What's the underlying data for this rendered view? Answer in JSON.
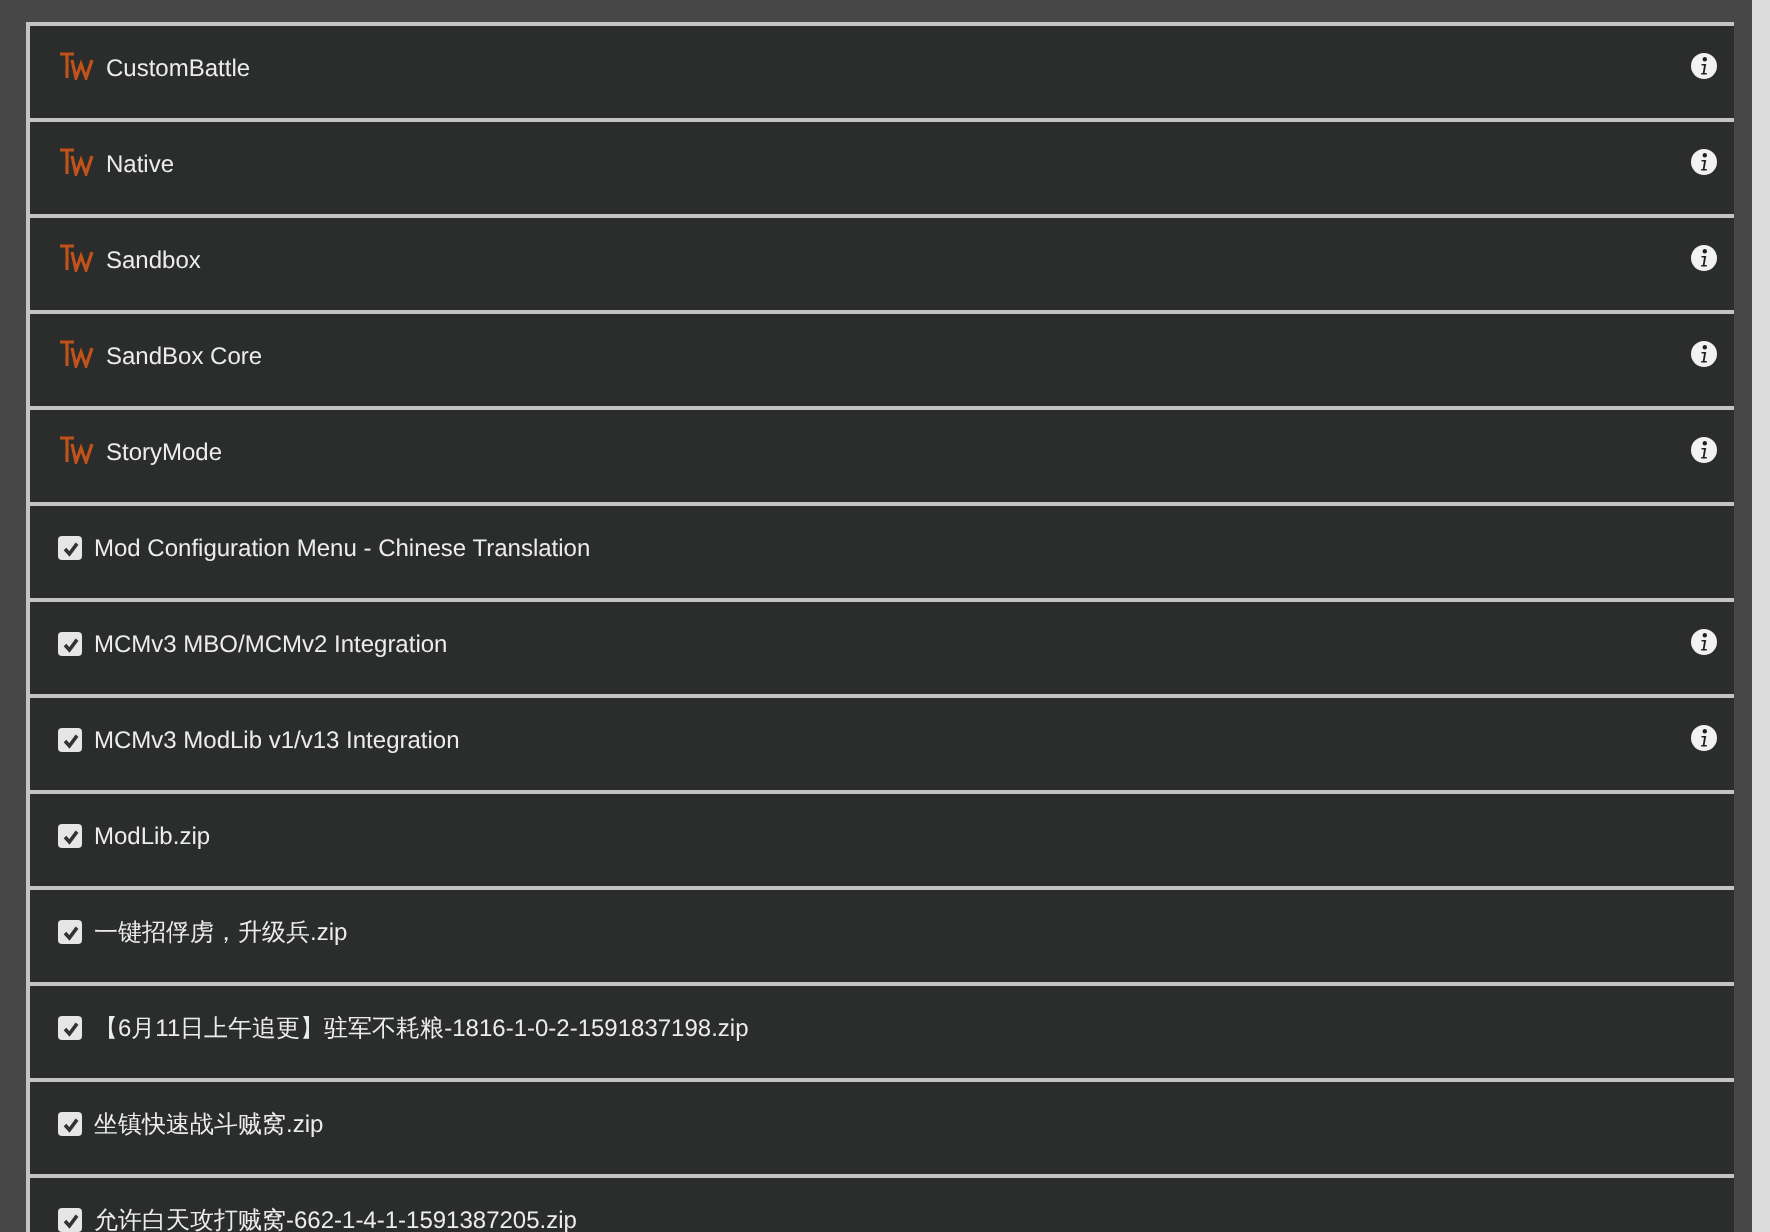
{
  "mods": [
    {
      "kind": "native",
      "name": "CustomBattle",
      "info": true
    },
    {
      "kind": "native",
      "name": "Native",
      "info": true
    },
    {
      "kind": "native",
      "name": "Sandbox",
      "info": true
    },
    {
      "kind": "native",
      "name": "SandBox Core",
      "info": true
    },
    {
      "kind": "native",
      "name": "StoryMode",
      "info": true
    },
    {
      "kind": "mod",
      "name": "Mod Configuration Menu - Chinese Translation",
      "checked": true,
      "info": false
    },
    {
      "kind": "mod",
      "name": "MCMv3 MBO/MCMv2 Integration",
      "checked": true,
      "info": true
    },
    {
      "kind": "mod",
      "name": "MCMv3 ModLib v1/v13 Integration",
      "checked": true,
      "info": true
    },
    {
      "kind": "mod",
      "name": "ModLib.zip",
      "checked": true,
      "info": false
    },
    {
      "kind": "mod",
      "name": "一键招俘虏，升级兵.zip",
      "checked": true,
      "info": false
    },
    {
      "kind": "mod",
      "name": "【6月11日上午追更】驻军不耗粮-1816-1-0-2-1591837198.zip",
      "checked": true,
      "info": false
    },
    {
      "kind": "mod",
      "name": "坐镇快速战斗贼窝.zip",
      "checked": true,
      "info": false
    },
    {
      "kind": "mod",
      "name": "允许白天攻打贼窝-662-1-4-1-1591387205.zip",
      "checked": true,
      "info": false
    }
  ]
}
